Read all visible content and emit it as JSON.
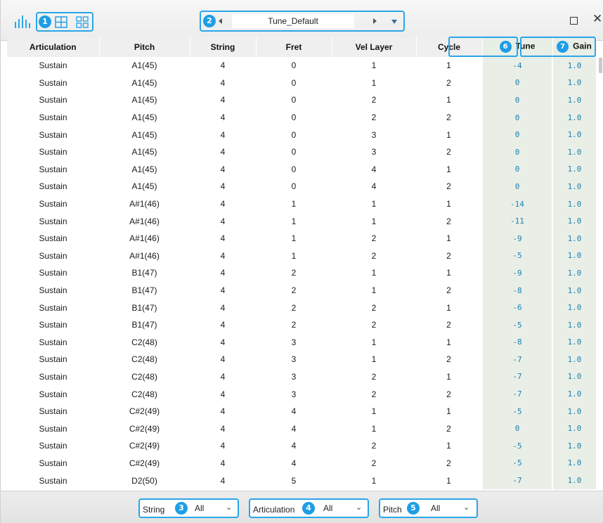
{
  "toolbar": {
    "view_badge": "1",
    "preset_badge": "2",
    "preset_name": "Tune_Default"
  },
  "table": {
    "columns": [
      "Articulation",
      "Pitch",
      "String",
      "Fret",
      "Vel Layer",
      "Cycle",
      "Tune",
      "Gain"
    ],
    "tune_badge": "6",
    "gain_badge": "7",
    "rows": [
      [
        "Sustain",
        "A1(45)",
        "4",
        "0",
        "1",
        "1",
        "-4",
        "1.0"
      ],
      [
        "Sustain",
        "A1(45)",
        "4",
        "0",
        "1",
        "2",
        "0",
        "1.0"
      ],
      [
        "Sustain",
        "A1(45)",
        "4",
        "0",
        "2",
        "1",
        "0",
        "1.0"
      ],
      [
        "Sustain",
        "A1(45)",
        "4",
        "0",
        "2",
        "2",
        "0",
        "1.0"
      ],
      [
        "Sustain",
        "A1(45)",
        "4",
        "0",
        "3",
        "1",
        "0",
        "1.0"
      ],
      [
        "Sustain",
        "A1(45)",
        "4",
        "0",
        "3",
        "2",
        "0",
        "1.0"
      ],
      [
        "Sustain",
        "A1(45)",
        "4",
        "0",
        "4",
        "1",
        "0",
        "1.0"
      ],
      [
        "Sustain",
        "A1(45)",
        "4",
        "0",
        "4",
        "2",
        "0",
        "1.0"
      ],
      [
        "Sustain",
        "A#1(46)",
        "4",
        "1",
        "1",
        "1",
        "-14",
        "1.0"
      ],
      [
        "Sustain",
        "A#1(46)",
        "4",
        "1",
        "1",
        "2",
        "-11",
        "1.0"
      ],
      [
        "Sustain",
        "A#1(46)",
        "4",
        "1",
        "2",
        "1",
        "-9",
        "1.0"
      ],
      [
        "Sustain",
        "A#1(46)",
        "4",
        "1",
        "2",
        "2",
        "-5",
        "1.0"
      ],
      [
        "Sustain",
        "B1(47)",
        "4",
        "2",
        "1",
        "1",
        "-9",
        "1.0"
      ],
      [
        "Sustain",
        "B1(47)",
        "4",
        "2",
        "1",
        "2",
        "-8",
        "1.0"
      ],
      [
        "Sustain",
        "B1(47)",
        "4",
        "2",
        "2",
        "1",
        "-6",
        "1.0"
      ],
      [
        "Sustain",
        "B1(47)",
        "4",
        "2",
        "2",
        "2",
        "-5",
        "1.0"
      ],
      [
        "Sustain",
        "C2(48)",
        "4",
        "3",
        "1",
        "1",
        "-8",
        "1.0"
      ],
      [
        "Sustain",
        "C2(48)",
        "4",
        "3",
        "1",
        "2",
        "-7",
        "1.0"
      ],
      [
        "Sustain",
        "C2(48)",
        "4",
        "3",
        "2",
        "1",
        "-7",
        "1.0"
      ],
      [
        "Sustain",
        "C2(48)",
        "4",
        "3",
        "2",
        "2",
        "-7",
        "1.0"
      ],
      [
        "Sustain",
        "C#2(49)",
        "4",
        "4",
        "1",
        "1",
        "-5",
        "1.0"
      ],
      [
        "Sustain",
        "C#2(49)",
        "4",
        "4",
        "1",
        "2",
        "0",
        "1.0"
      ],
      [
        "Sustain",
        "C#2(49)",
        "4",
        "4",
        "2",
        "1",
        "-5",
        "1.0"
      ],
      [
        "Sustain",
        "C#2(49)",
        "4",
        "4",
        "2",
        "2",
        "-5",
        "1.0"
      ],
      [
        "Sustain",
        "D2(50)",
        "4",
        "5",
        "1",
        "1",
        "-7",
        "1.0"
      ]
    ]
  },
  "filters": [
    {
      "label": "String",
      "badge": "3",
      "value": "All"
    },
    {
      "label": "Articulation",
      "badge": "4",
      "value": "All"
    },
    {
      "label": "Pitch",
      "badge": "5",
      "value": "All"
    }
  ],
  "colors": {
    "accent": "#2aa6e8",
    "badge": "#1e9ee6",
    "tune_gain_bg": "#e9efe6",
    "tune_gain_text": "#1d7fb3"
  },
  "icons": {
    "view_bars": "bar-chart-icon",
    "view_grid_large": "grid-2x2-icon",
    "view_grid_small": "grid-small-icon",
    "prev": "triangle-left-icon",
    "next": "triangle-right-icon",
    "dropdown": "triangle-down-icon",
    "maximize": "square-icon",
    "close": "close-icon"
  }
}
